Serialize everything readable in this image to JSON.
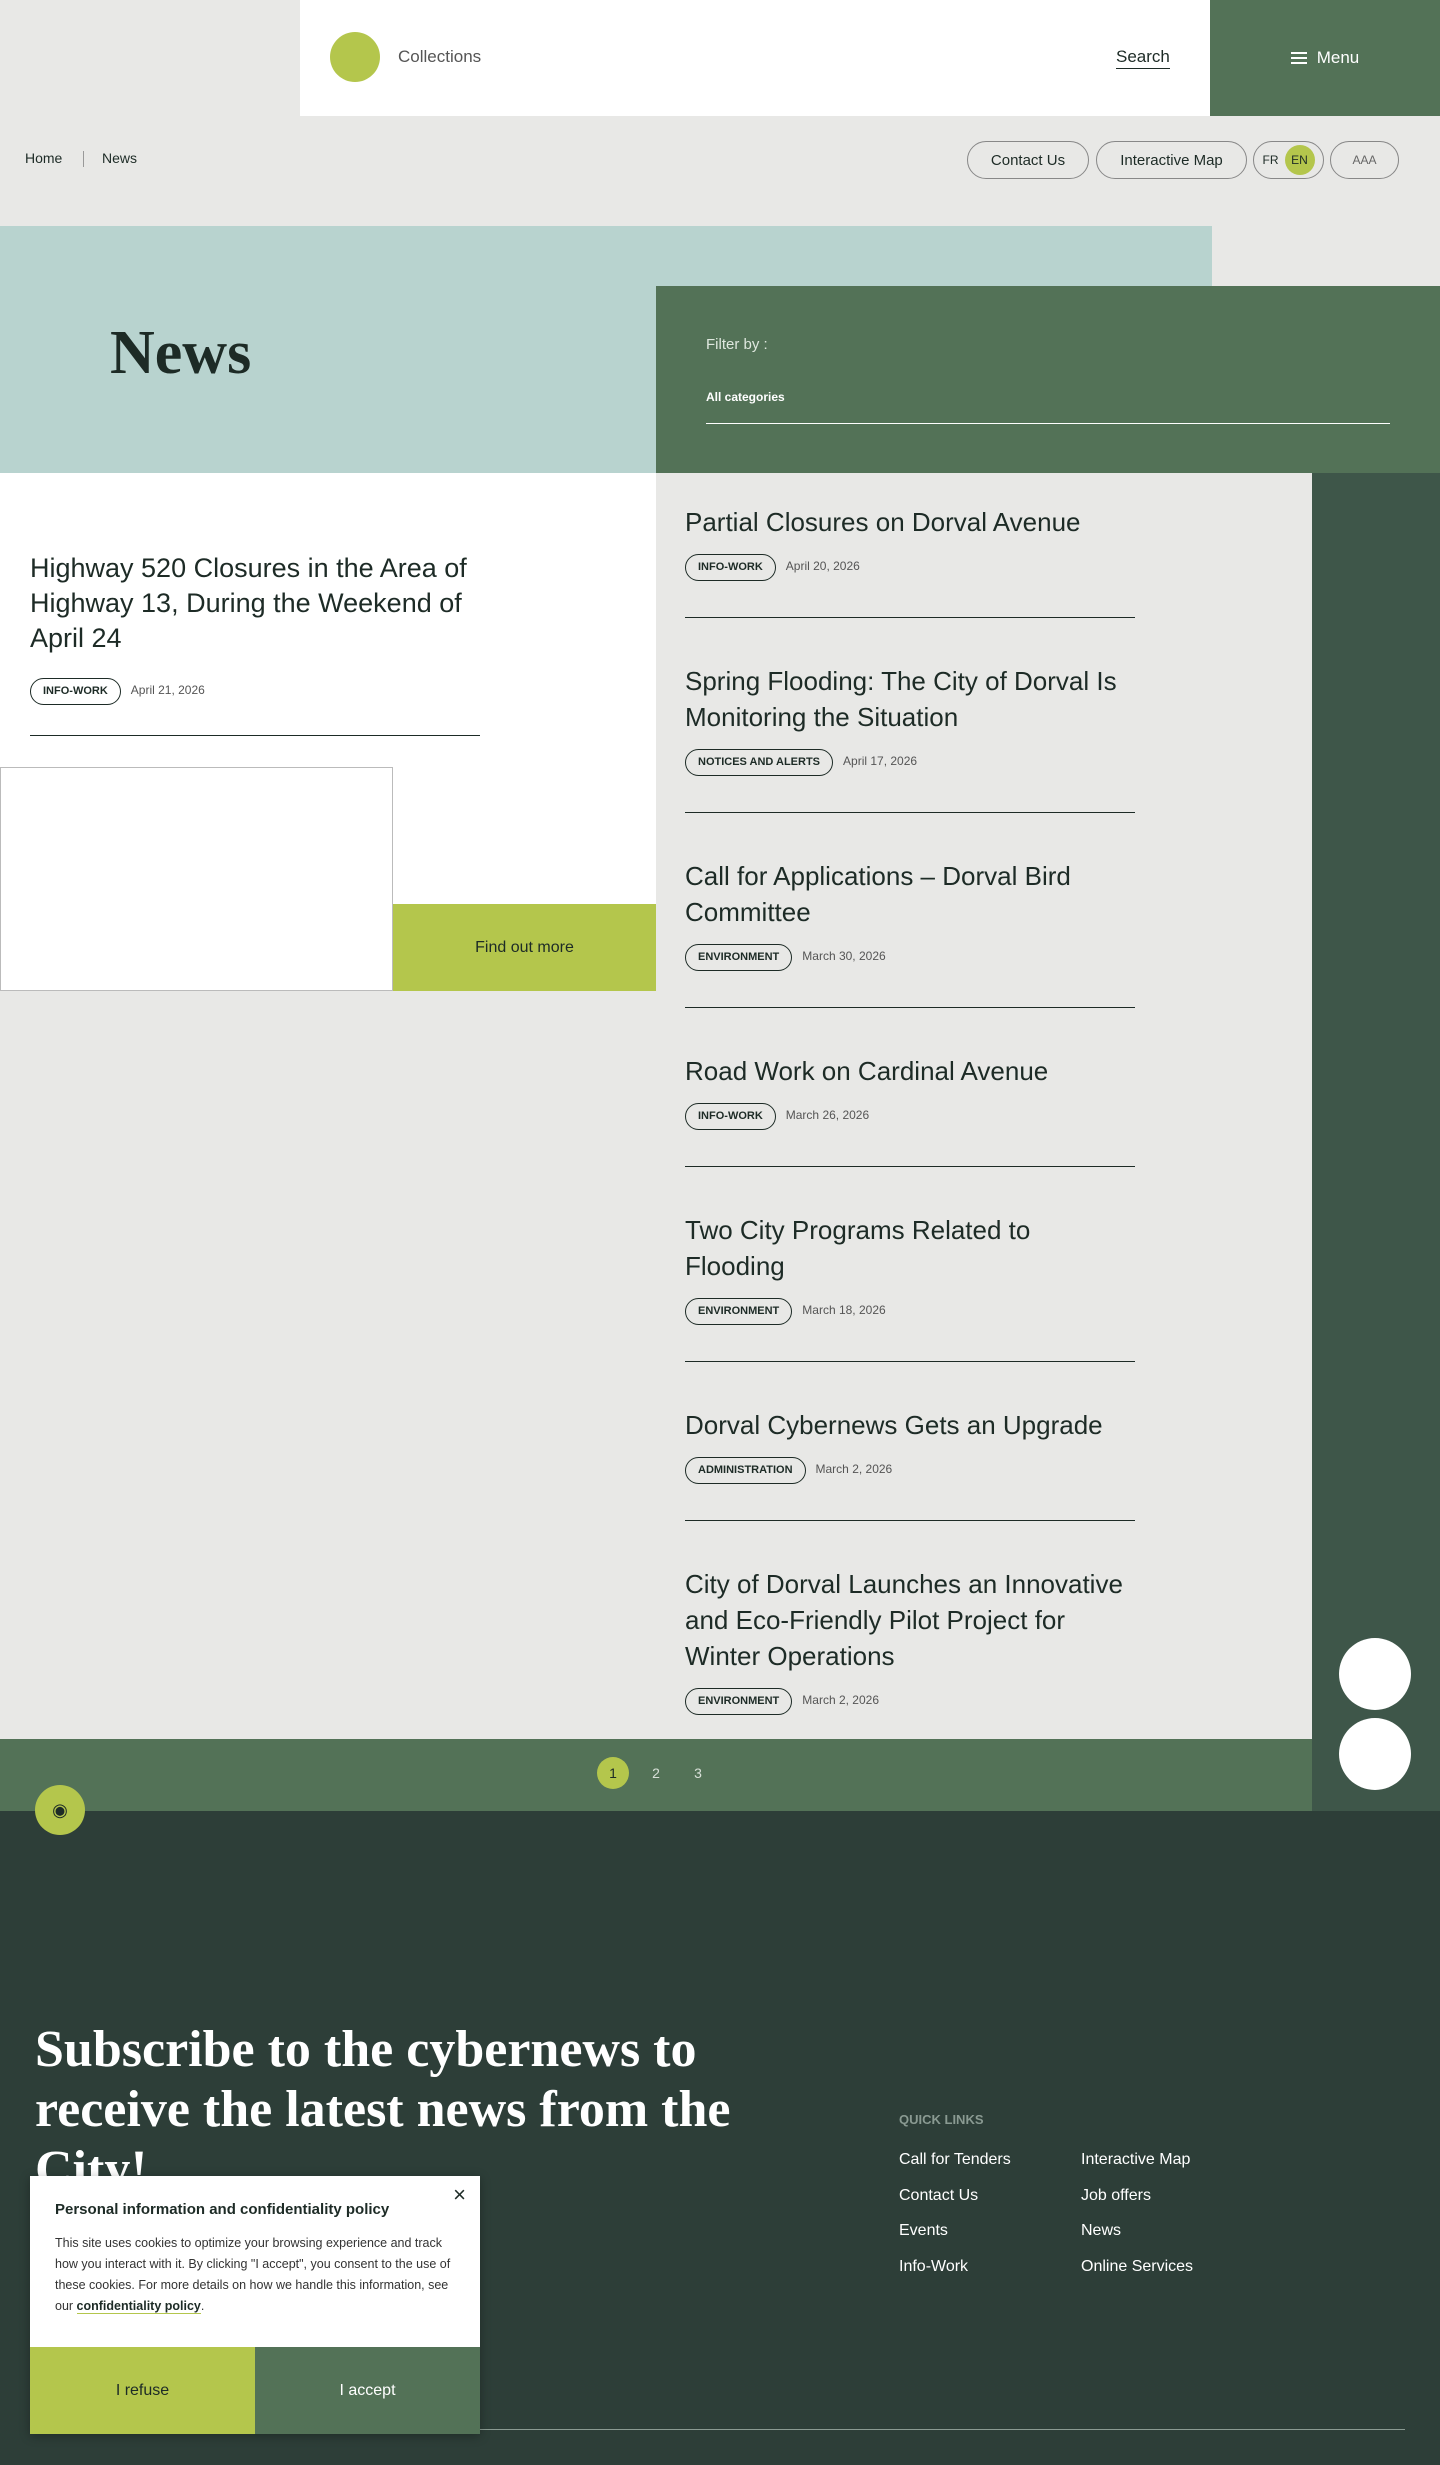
{
  "header": {
    "site": "Collections",
    "search": "Search",
    "menu": "Menu"
  },
  "breadcrumb": {
    "home": "Home",
    "current": "News"
  },
  "utility": {
    "contact": "Contact Us",
    "map": "Interactive Map",
    "fr": "FR",
    "en": "EN",
    "text_size": "AAA"
  },
  "page": {
    "title": "News",
    "filter_label": "Filter by :",
    "filter_value": "All categories"
  },
  "featured": {
    "title": "Highway 520 Closures in the Area of Highway 13, During the Weekend of April 24",
    "tag": "INFO-WORK",
    "date": "April 21, 2026",
    "cta": "Find out more"
  },
  "articles": [
    {
      "title": "Partial Closures on Dorval Avenue",
      "tag": "INFO-WORK",
      "date": "April 20, 2026"
    },
    {
      "title": "Spring Flooding: The City of Dorval Is Monitoring the Situation",
      "tag": "NOTICES AND ALERTS",
      "date": "April 17, 2026"
    },
    {
      "title": "Call for Applications – Dorval Bird Committee",
      "tag": "ENVIRONMENT",
      "date": "March 30, 2026"
    },
    {
      "title": "Road Work on Cardinal Avenue",
      "tag": "INFO-WORK",
      "date": "March 26, 2026"
    },
    {
      "title": "Two City Programs Related to Flooding",
      "tag": "ENVIRONMENT",
      "date": "March 18, 2026"
    },
    {
      "title": "Dorval Cybernews Gets an Upgrade",
      "tag": "ADMINISTRATION",
      "date": "March 2, 2026"
    },
    {
      "title": "City of Dorval Launches an Innovative and Eco-Friendly Pilot Project for Winter Operations",
      "tag": "ENVIRONMENT",
      "date": "March 2, 2026"
    }
  ],
  "pagination": {
    "pages": [
      "1",
      "2",
      "3"
    ],
    "current": "1"
  },
  "footer": {
    "subscribe": "Subscribe to the cybernews to receive the latest news from the City!",
    "quick_links_title": "QUICK LINKS",
    "links": [
      "Call for Tenders",
      "Interactive Map",
      "Contact Us",
      "Job offers",
      "Events",
      "News",
      "Info-Work",
      "Online Services"
    ]
  },
  "cookie": {
    "title": "Personal information and confidentiality policy",
    "close": "×",
    "body": "This site uses cookies to optimize your browsing experience and track how you interact with it. By clicking \"I accept\", you consent to the use of these cookies. For more details on how we handle this information, see our ",
    "link": "confidentiality policy",
    "period": ".",
    "refuse": "I refuse",
    "accept": "I accept"
  },
  "colors": {
    "lime": "#b4c64c",
    "green": "#537257",
    "teal": "#b8d3cf",
    "dark": "#2d3e38"
  }
}
